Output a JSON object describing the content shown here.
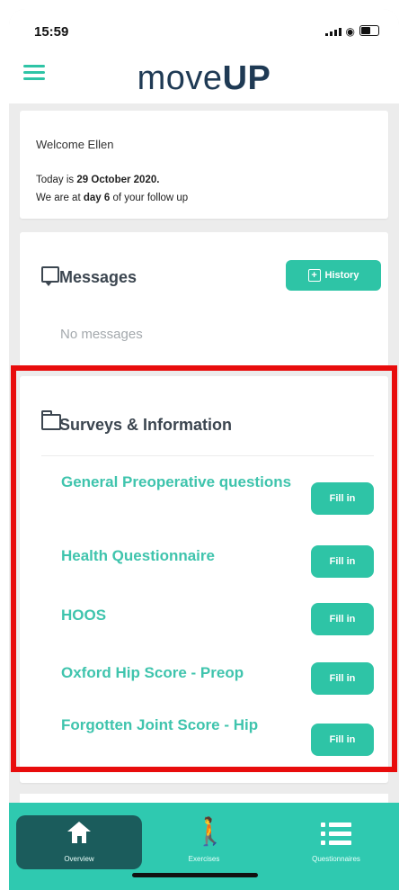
{
  "status_bar": {
    "time": "15:59"
  },
  "app": {
    "logo_light": "move",
    "logo_bold": "UP"
  },
  "welcome": {
    "greeting": "Welcome Ellen",
    "date_prefix": "Today is ",
    "date": "29 October 2020.",
    "day_prefix": "We are at ",
    "day": "day 6",
    "day_suffix": " of your follow up"
  },
  "messages": {
    "title": "Messages",
    "history_label": "History",
    "empty_text": "No messages"
  },
  "surveys": {
    "title": "Surveys & Information",
    "items": [
      {
        "label": "General Preoperative questions",
        "button": "Fill in"
      },
      {
        "label": "Health Questionnaire",
        "button": "Fill in"
      },
      {
        "label": "HOOS",
        "button": "Fill in"
      },
      {
        "label": "Oxford Hip Score - Preop",
        "button": "Fill in"
      },
      {
        "label": "Forgotten Joint Score - Hip",
        "button": "Fill in"
      }
    ]
  },
  "tabbar": {
    "tabs": [
      {
        "label": "Overview",
        "icon": "home-icon",
        "active": true
      },
      {
        "label": "Exercises",
        "icon": "walking-icon",
        "active": false
      },
      {
        "label": "Questionnaires",
        "icon": "list-icon",
        "active": false
      }
    ]
  },
  "colors": {
    "accent": "#2ec4a6",
    "text_dark": "#3c4650",
    "highlight": "#e80c0c",
    "tab_active": "#1b5c5c"
  }
}
